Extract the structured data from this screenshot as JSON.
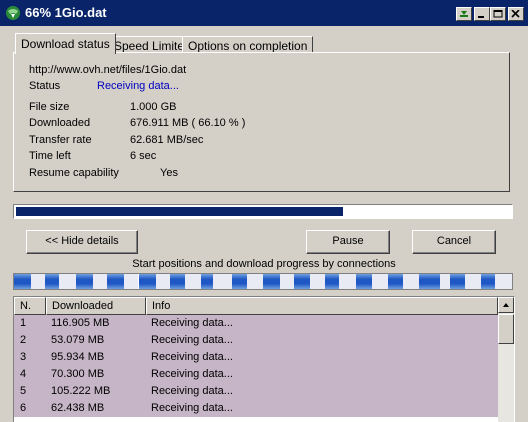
{
  "window": {
    "title": "66% 1Gio.dat",
    "icon": "globe-download-icon"
  },
  "tabs": [
    {
      "label": "Download status",
      "active": true
    },
    {
      "label": "Speed Limiter",
      "active": false
    },
    {
      "label": "Options on completion",
      "active": false
    }
  ],
  "status": {
    "url": "http://www.ovh.net/files/1Gio.dat",
    "status_label": "Status",
    "status_value": "Receiving data...",
    "file_size_label": "File size",
    "file_size_value": "1.000  GB",
    "downloaded_label": "Downloaded",
    "downloaded_value": "676.911  MB  ( 66.10 % )",
    "transfer_rate_label": "Transfer rate",
    "transfer_rate_value": "62.681  MB/sec",
    "time_left_label": "Time left",
    "time_left_value": "6 sec",
    "resume_label": "Resume capability",
    "resume_value": "Yes"
  },
  "progress": {
    "fraction": 0.661
  },
  "buttons": {
    "hide_details": "<< Hide details",
    "pause": "Pause",
    "cancel": "Cancel"
  },
  "connections": {
    "caption": "Start positions and download progress by connections",
    "progress_fractions": [
      0.55,
      0.45,
      0.55,
      0.55,
      0.55,
      0.5,
      0.4,
      0.5,
      0.55,
      0.5,
      0.45,
      0.5,
      0.5,
      0.7,
      0.5,
      0.45
    ],
    "colors": {
      "done": "#1f57c4",
      "edge": "#6fa0e0",
      "remaining": "#e8eaf4"
    }
  },
  "table": {
    "columns": [
      "N.",
      "Downloaded",
      "Info"
    ],
    "rows": [
      {
        "n": "1",
        "downloaded": "116.905  MB",
        "info": "Receiving data..."
      },
      {
        "n": "2",
        "downloaded": "53.079  MB",
        "info": "Receiving data..."
      },
      {
        "n": "3",
        "downloaded": "95.934  MB",
        "info": "Receiving data..."
      },
      {
        "n": "4",
        "downloaded": "70.300  MB",
        "info": "Receiving data..."
      },
      {
        "n": "5",
        "downloaded": "105.222  MB",
        "info": "Receiving data..."
      },
      {
        "n": "6",
        "downloaded": "62.438  MB",
        "info": "Receiving data..."
      }
    ]
  }
}
